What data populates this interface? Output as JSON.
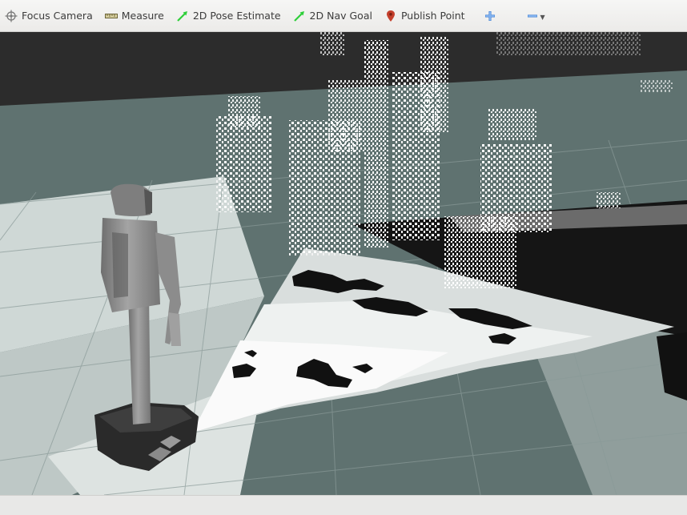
{
  "toolbar": {
    "focus_camera": {
      "label": "Focus Camera",
      "icon": "crosshair-icon"
    },
    "measure": {
      "label": "Measure",
      "icon": "ruler-icon"
    },
    "pose_estimate": {
      "label": "2D Pose Estimate",
      "icon": "green-arrow-icon"
    },
    "nav_goal": {
      "label": "2D Nav Goal",
      "icon": "green-arrow-icon"
    },
    "publish_point": {
      "label": "Publish Point",
      "icon": "map-pin-icon"
    },
    "add_tool": {
      "icon": "plus-icon"
    },
    "remove_tool": {
      "icon": "minus-icon",
      "dropdown": "chevron-down-icon"
    }
  },
  "viewport": {
    "scene": "3D view",
    "colors": {
      "sky": "#2c2c2c",
      "floor": "#5f7270",
      "floor_light": "#d6dedc",
      "grid": "#8a9a98",
      "pointcloud": "#ffffff",
      "robot": "#8a8a8a",
      "robot_base": "#2a2a2a",
      "arrow_green": "#2fcf3a",
      "pin_red": "#c4402d",
      "accent_blue": "#3b7bd0"
    }
  }
}
